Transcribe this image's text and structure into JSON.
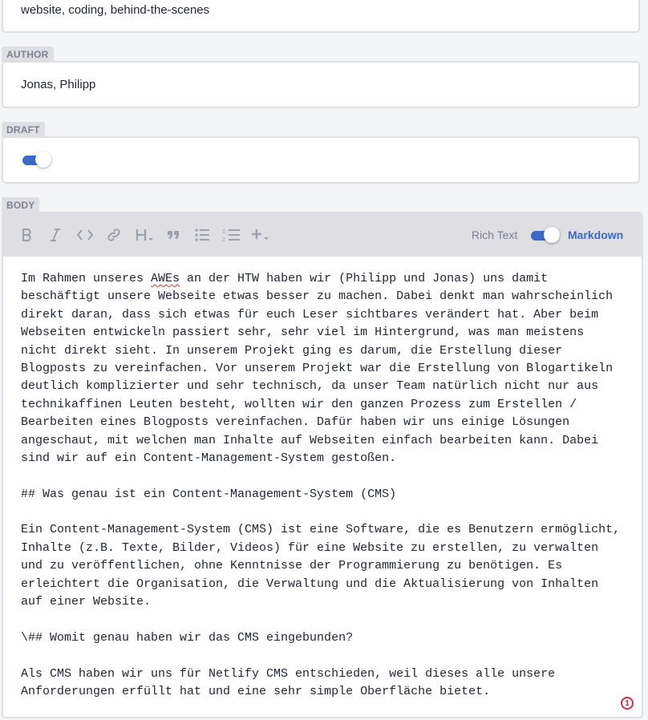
{
  "tags_field": {
    "value": "website, coding, behind-the-scenes"
  },
  "author_field": {
    "label": "AUTHOR",
    "value": "Jonas, Philipp"
  },
  "draft_field": {
    "label": "DRAFT",
    "enabled": true
  },
  "body_field": {
    "label": "BODY",
    "toolbar": {
      "icons": [
        "bold-icon",
        "italic-icon",
        "code-icon",
        "link-icon",
        "heading-icon",
        "quote-icon",
        "bulleted-list-icon",
        "numbered-list-icon",
        "add-component-icon"
      ],
      "mode_rich_text": "Rich Text",
      "mode_markdown": "Markdown",
      "markdown_enabled": true
    },
    "lines": [
      [
        "Im Rahmen unseres ",
        "AWEs",
        " an der HTW haben wir (Philipp und Jonas) uns damit"
      ],
      [
        "beschäftigt unsere Webseite etwas besser zu machen. Dabei denkt man wahrscheinlich"
      ],
      [
        "direkt daran, dass sich etwas für euch Leser sichtbares verändert hat. Aber beim"
      ],
      [
        "Webseiten entwickeln passiert sehr, sehr viel im Hintergrund, was man meistens"
      ],
      [
        "nicht direkt sieht. In unserem Projekt ging es darum, die Erstellung dieser"
      ],
      [
        "Blogposts zu vereinfachen. Vor unserem Projekt war die Erstellung von Blogartikeln"
      ],
      [
        "deutlich komplizierter und sehr technisch, da unser Team natürlich nicht nur aus"
      ],
      [
        "technikaffinen Leuten besteht, wollten wir den ganzen Prozess zum Erstellen /"
      ],
      [
        "Bearbeiten eines Blogposts vereinfachen. Dafür haben wir uns einige Lösungen"
      ],
      [
        "angeschaut, mit welchen man Inhalte auf Webseiten einfach bearbeiten kann. Dabei"
      ],
      [
        "sind wir auf ein Content-Management-System gestoßen."
      ],
      [
        ""
      ],
      [
        "## Was genau ist ein Content-Management-System (CMS)"
      ],
      [
        ""
      ],
      [
        "Ein Content-Management-System (CMS) ist eine Software, die es Benutzern ermöglicht,"
      ],
      [
        "Inhalte (z.B. Texte, Bilder, Videos) für eine Website zu erstellen, zu verwalten"
      ],
      [
        "und zu veröffentlichen, ohne Kenntnisse der Programmierung zu benötigen. Es"
      ],
      [
        "erleichtert die Organisation, die Verwaltung und die Aktualisierung von Inhalten"
      ],
      [
        "auf einer Website."
      ],
      [
        ""
      ],
      [
        "\\## Womit genau haben wir das CMS eingebunden?"
      ],
      [
        ""
      ],
      [
        "Als CMS haben wir uns für Netlify CMS entschieden, weil dieses alle unsere"
      ],
      [
        "Anforderungen erfüllt hat und eine sehr simple Oberfläche bietet."
      ]
    ],
    "spellcheck_badge": "1"
  },
  "colors": {
    "accent": "#3a69c7",
    "label_bg": "#dfdfe3",
    "label_text": "#7a8291",
    "error": "#d92b4b"
  }
}
